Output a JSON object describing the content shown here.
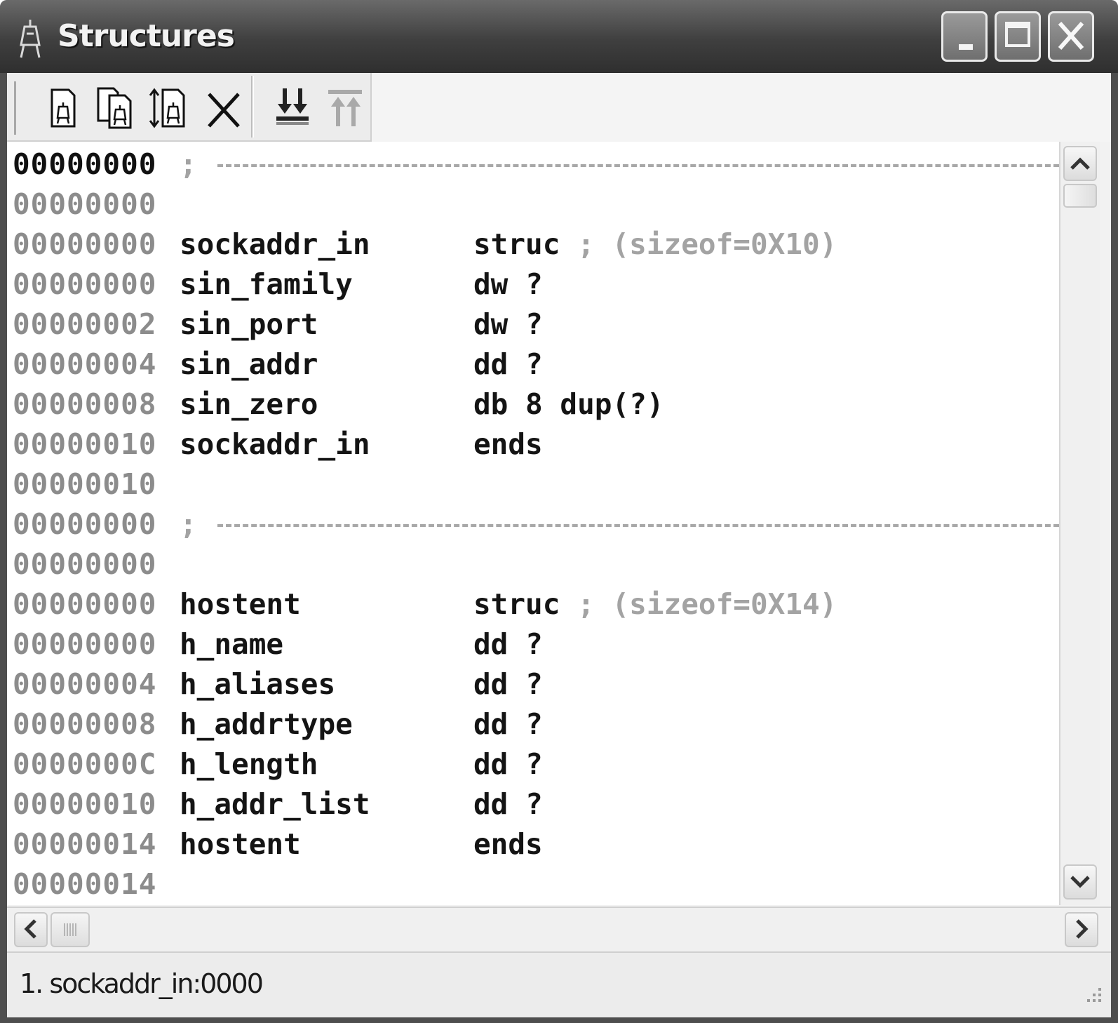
{
  "window": {
    "title": "Structures",
    "icon": "ida-structures-icon",
    "controls": [
      "minimize-icon",
      "maximize-icon",
      "close-icon"
    ]
  },
  "toolbar": {
    "tools": [
      {
        "name": "add-struct-type",
        "icon": "add-struct-icon"
      },
      {
        "name": "add-copy-struct-type",
        "icon": "duplicate-struct-icon"
      },
      {
        "name": "expand-struct",
        "icon": "expand-struct-icon"
      },
      {
        "name": "delete-struct-type",
        "icon": "delete-x-icon"
      },
      {
        "name": "collapse-all",
        "icon": "down-arrows-icon"
      },
      {
        "name": "expand-all",
        "icon": "up-arrows-disabled-icon"
      }
    ]
  },
  "listing": {
    "lines": [
      {
        "addr": "00000000",
        "kind": "separator",
        "semicolon": ";"
      },
      {
        "addr": "00000000",
        "kind": "blank"
      },
      {
        "addr": "00000000",
        "name": "sockaddr_in",
        "dir": "struc",
        "comment": "; (sizeof=0X10)"
      },
      {
        "addr": "00000000",
        "name": "sin_family",
        "dir": "dw ?"
      },
      {
        "addr": "00000002",
        "name": "sin_port",
        "dir": "dw ?"
      },
      {
        "addr": "00000004",
        "name": "sin_addr",
        "dir": "dd ?"
      },
      {
        "addr": "00000008",
        "name": "sin_zero",
        "dir": "db 8 dup(?)"
      },
      {
        "addr": "00000010",
        "name": "sockaddr_in",
        "dir": "ends"
      },
      {
        "addr": "00000010",
        "kind": "blank"
      },
      {
        "addr": "00000000",
        "kind": "separator",
        "semicolon": ";"
      },
      {
        "addr": "00000000",
        "kind": "blank"
      },
      {
        "addr": "00000000",
        "name": "hostent",
        "dir": "struc",
        "comment": "; (sizeof=0X14)"
      },
      {
        "addr": "00000000",
        "name": "h_name",
        "dir": "dd ?"
      },
      {
        "addr": "00000004",
        "name": "h_aliases",
        "dir": "dd ?"
      },
      {
        "addr": "00000008",
        "name": "h_addrtype",
        "dir": "dd ?"
      },
      {
        "addr": "0000000C",
        "name": "h_length",
        "dir": "dd ?"
      },
      {
        "addr": "00000010",
        "name": "h_addr_list",
        "dir": "dd ?"
      },
      {
        "addr": "00000014",
        "name": "hostent",
        "dir": "ends"
      },
      {
        "addr": "00000014",
        "kind": "blank"
      }
    ]
  },
  "status": {
    "text": "1. sockaddr_in:0000"
  }
}
